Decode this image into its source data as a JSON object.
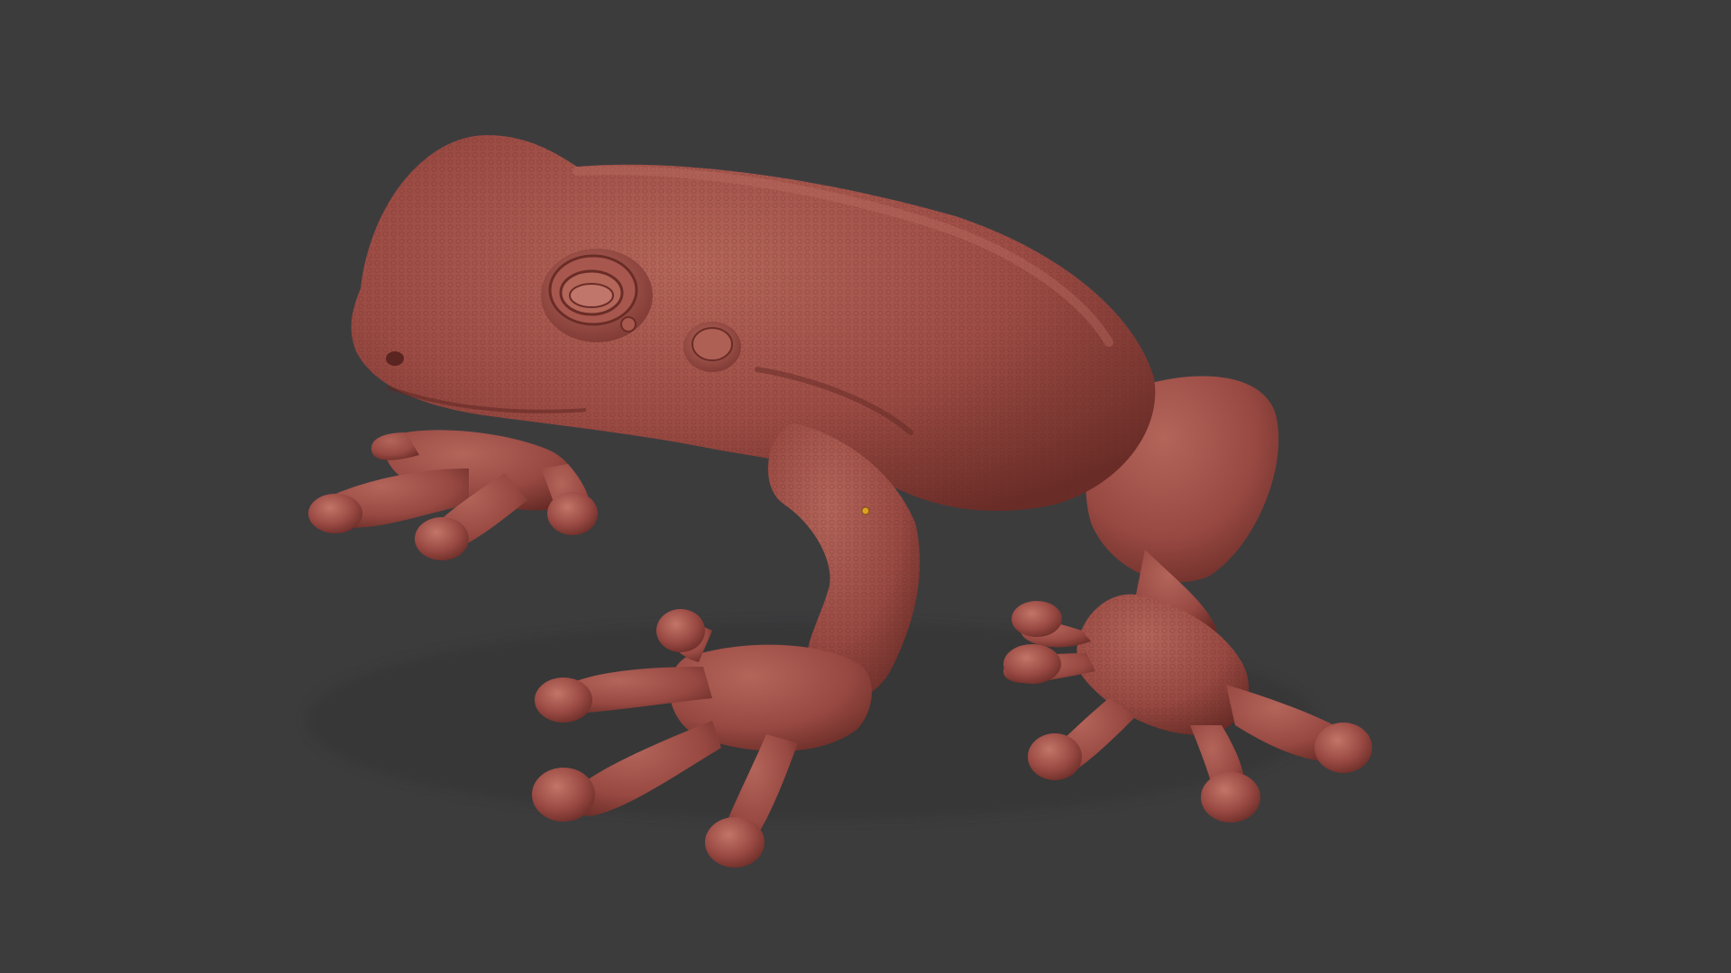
{
  "viewport": {
    "background_color": "#3c3c3d",
    "subject": "frog-sculpt",
    "material_color": "#9c4c44",
    "material_shadow": "#6a2c27",
    "material_highlight": "#c17668",
    "brush_cursor_color": "#e0a020"
  }
}
